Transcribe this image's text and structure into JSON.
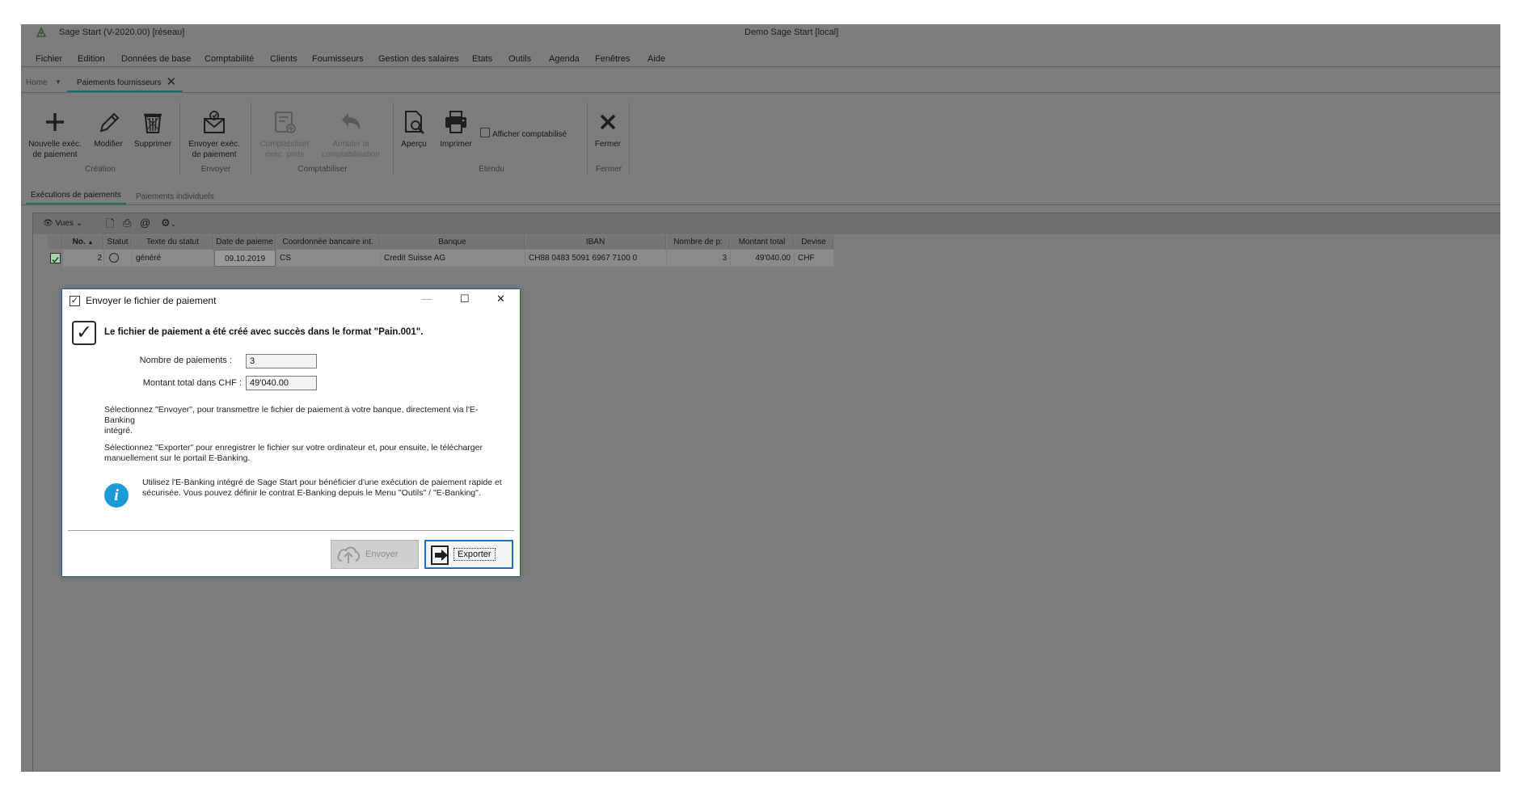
{
  "window": {
    "app_title": "Sage Start (V-2020.00) [réseau]",
    "center_title": "Demo Sage Start [local]"
  },
  "menu": [
    "Fichier",
    "Edition",
    "Données de base",
    "Comptabilité",
    "Clients",
    "Fournisseurs",
    "Gestion des salaires",
    "Etats",
    "Outils",
    "Agenda",
    "Fenêtres",
    "Aide"
  ],
  "tabs": {
    "home": "Home",
    "active": "Paiements fournisseurs"
  },
  "ribbon": {
    "new_l1": "Nouvelle exéc.",
    "new_l2": "de paiement",
    "modify": "Modifier",
    "delete": "Supprimer",
    "send_l1": "Envoyer exéc.",
    "send_l2": "de paiement",
    "post_l1": "Comptabiliser",
    "post_l2": "exéc. pmts",
    "cancel_l1": "Annuler la",
    "cancel_l2": "comptabilisation",
    "preview": "Aperçu",
    "print": "Imprimer",
    "show_posted": "Afficher comptabilisé",
    "close": "Fermer",
    "groups": {
      "creation": "Création",
      "send": "Envoyer",
      "post": "Comptabiliser",
      "extended": "Étendu",
      "close": "Fermer"
    }
  },
  "subtabs": {
    "active": "Exécutions de paiements",
    "other": "Paiements individuels"
  },
  "grid": {
    "views_label": "Vues",
    "columns": [
      "No.",
      "Statut",
      "Texte du statut",
      "Date de paieme",
      "Coordonnée bancaire int.",
      "Banque",
      "IBAN",
      "Nombre de p:",
      "Montant total",
      "Devise"
    ],
    "row": {
      "no": "2",
      "status_text": "généré",
      "date": "09.10.2019",
      "bank_coord": "CS",
      "bank": "Credit Suisse AG",
      "iban": "CH88 0483 5091 6967 7100 0",
      "count": "3",
      "total": "49'040.00",
      "currency": "CHF"
    }
  },
  "dialog": {
    "title": "Envoyer le fichier de paiement",
    "headline": "Le fichier de paiement a été créé avec succès dans le format \"Pain.001\".",
    "count_label": "Nombre de paiements :",
    "count_value": "3",
    "amount_label": "Montant total dans CHF :",
    "amount_value": "49'040.00",
    "para1_l1": "Sélectionnez \"Envoyer\", pour transmettre le fichier de paiement à votre banque, directement via l'E-Banking",
    "para1_l2": "intégré.",
    "para2_l1": "Sélectionnez \"Exporter\" pour enregistrer le fichier sur votre ordinateur et, pour ensuite, le télécharger",
    "para2_l2": "manuellement sur le portail E-Banking.",
    "info_l1": "Utilisez l'E-Banking intégré de Sage Start pour bénéficier d'une exécution de paiement rapide et",
    "info_l2": "sécurisée. Vous pouvez définir le contrat E-Banking depuis le Menu \"Outils\" / \"E-Banking\".",
    "send_button": "Envoyer",
    "export_button": "Exporter"
  }
}
